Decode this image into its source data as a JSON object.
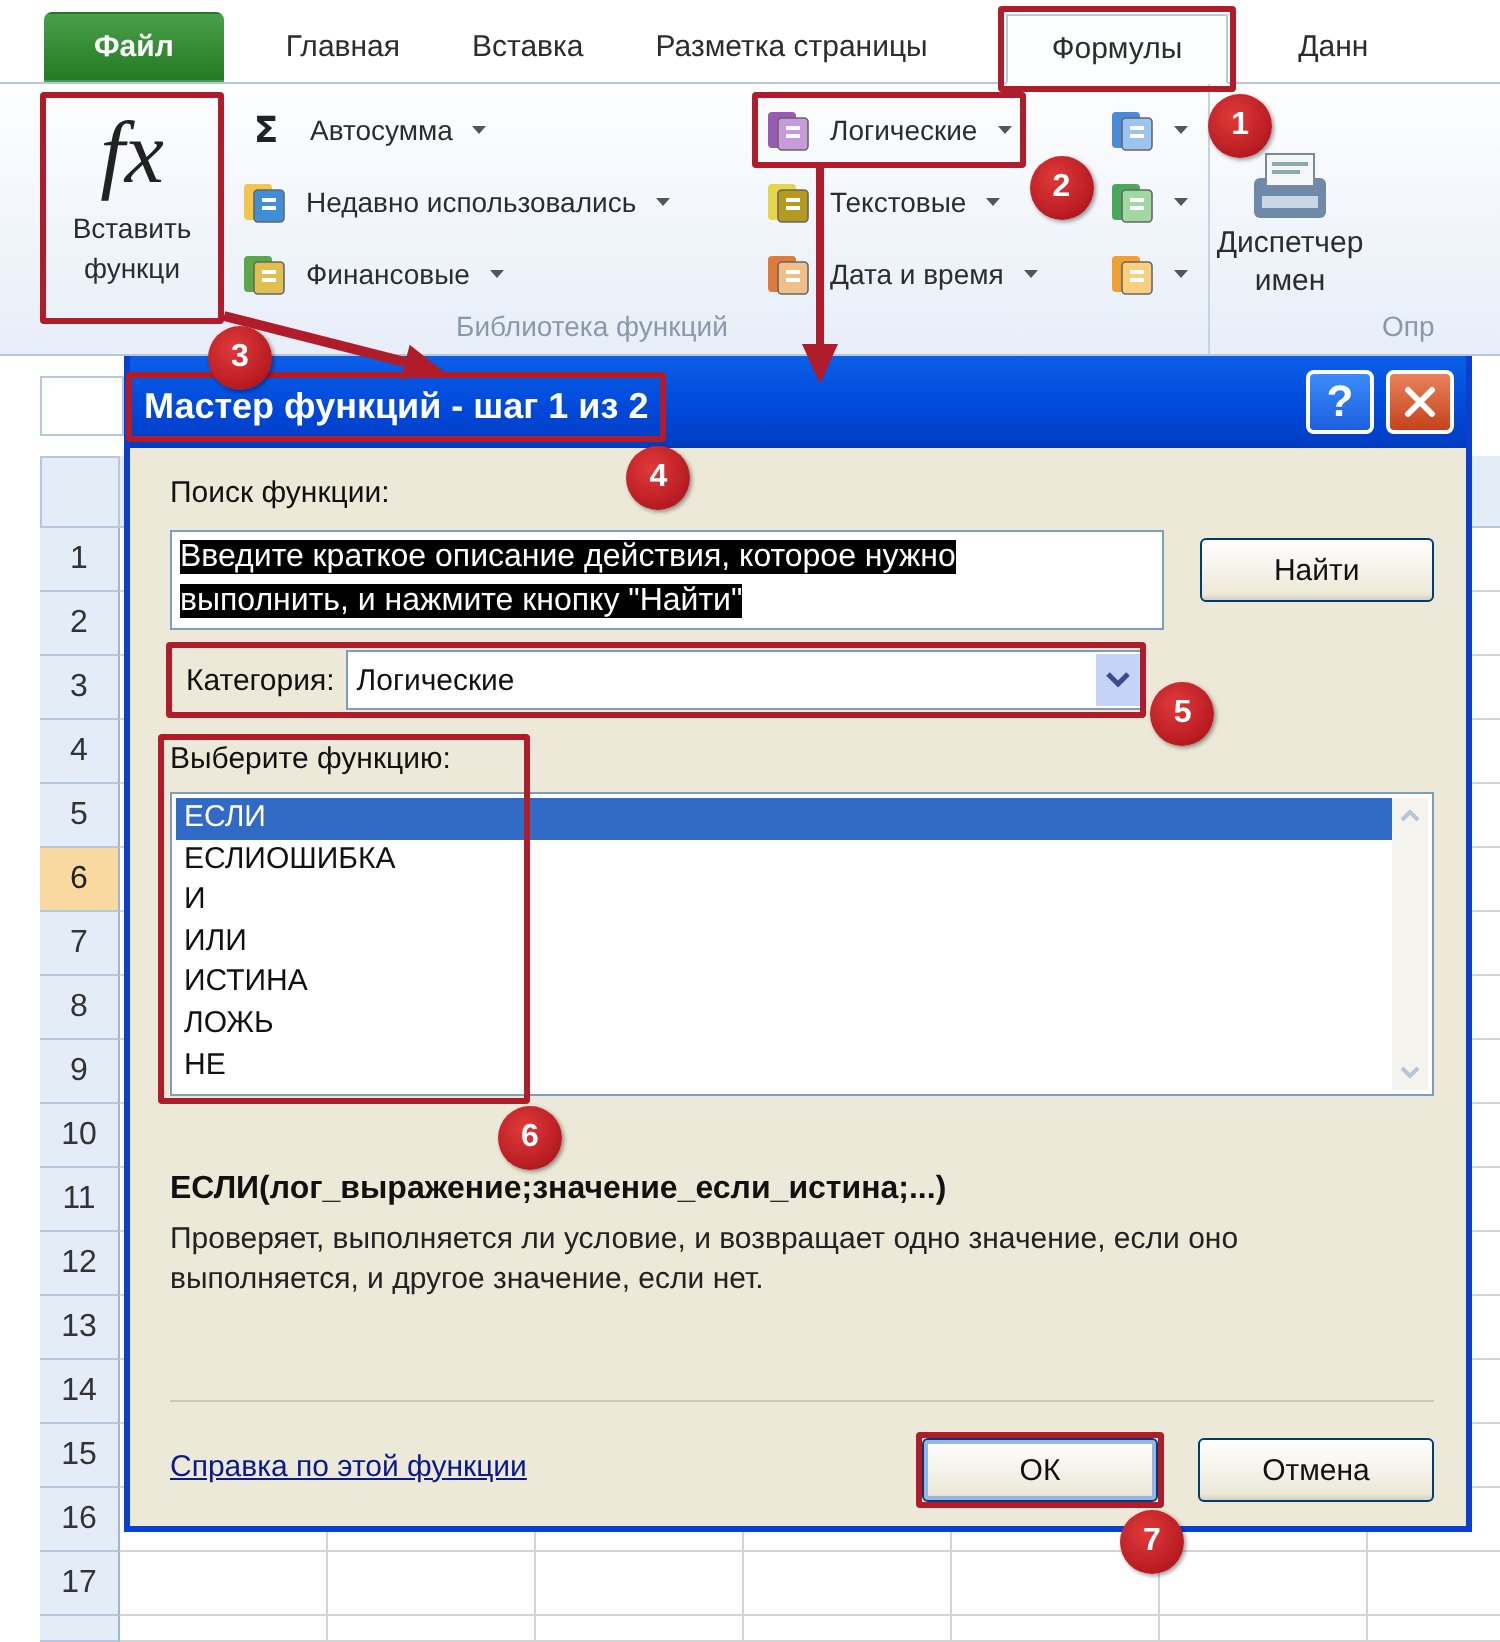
{
  "ribbon_tabs": [
    {
      "label": "Файл",
      "kind": "file",
      "selected": false
    },
    {
      "label": "Главная",
      "kind": "tab",
      "selected": false
    },
    {
      "label": "Вставка",
      "kind": "tab",
      "selected": false
    },
    {
      "label": "Разметка страницы",
      "kind": "tab",
      "selected": false
    },
    {
      "label": "Формулы",
      "kind": "tab",
      "selected": true
    },
    {
      "label": "Данн",
      "kind": "tab",
      "selected": false
    }
  ],
  "ribbon": {
    "insert_function": {
      "symbol": "fx",
      "label": "Вставить функци"
    },
    "library_columns": [
      [
        {
          "label": "Автосумма",
          "kind": "sigma",
          "icon_text": "Σ"
        },
        {
          "label": "Недавно использовались",
          "kind": "recent"
        },
        {
          "label": "Финансовые",
          "kind": "finance"
        }
      ],
      [
        {
          "label": "Логические",
          "kind": "logic"
        },
        {
          "label": "Текстовые",
          "kind": "text"
        },
        {
          "label": "Дата и время",
          "kind": "datetime"
        }
      ],
      [
        {
          "kind": "lookup"
        },
        {
          "kind": "math"
        },
        {
          "kind": "more"
        }
      ]
    ],
    "group_label": "Библиотека функций",
    "name_manager": "Диспетчер имен",
    "next_group_label": "Опр"
  },
  "sheet": {
    "rows": [
      {
        "label": "1",
        "selected": false
      },
      {
        "label": "2",
        "selected": false
      },
      {
        "label": "3",
        "selected": false
      },
      {
        "label": "4",
        "selected": false
      },
      {
        "label": "5",
        "selected": false
      },
      {
        "label": "6",
        "selected": true
      },
      {
        "label": "7",
        "selected": false
      },
      {
        "label": "8",
        "selected": false
      },
      {
        "label": "9",
        "selected": false
      },
      {
        "label": "10",
        "selected": false
      },
      {
        "label": "11",
        "selected": false
      },
      {
        "label": "12",
        "selected": false
      },
      {
        "label": "13",
        "selected": false
      },
      {
        "label": "14",
        "selected": false
      },
      {
        "label": "15",
        "selected": false
      },
      {
        "label": "16",
        "selected": false
      },
      {
        "label": "17",
        "selected": false
      }
    ]
  },
  "dialog": {
    "title": "Мастер функций - шаг 1 из 2",
    "help": "?",
    "search_label": "Поиск функции:",
    "search_value": "Введите краткое описание действия, которое нужно выполнить, и нажмите кнопку \"Найти\"",
    "find_button": "Найти",
    "category_label": "Категория:",
    "category_value": "Логические",
    "list_label": "Выберите функцию:",
    "functions": [
      {
        "name": "ЕСЛИ",
        "selected": true
      },
      {
        "name": "ЕСЛИОШИБКА",
        "selected": false
      },
      {
        "name": "И",
        "selected": false
      },
      {
        "name": "ИЛИ",
        "selected": false
      },
      {
        "name": "ИСТИНА",
        "selected": false
      },
      {
        "name": "ЛОЖЬ",
        "selected": false
      },
      {
        "name": "НЕ",
        "selected": false
      }
    ],
    "signature": "ЕСЛИ(лог_выражение;значение_если_истина;...)",
    "description": "Проверяет, выполняется ли условие, и возвращает одно значение, если оно выполняется, и другое значение, если нет.",
    "help_link": "Справка по этой функции",
    "buttons": [
      {
        "label": "ОК",
        "kind": "ok"
      },
      {
        "label": "Отмена",
        "kind": "cancel"
      }
    ]
  },
  "annotations": {
    "badges": [
      "1",
      "2",
      "3",
      "4",
      "5",
      "6",
      "7"
    ]
  }
}
